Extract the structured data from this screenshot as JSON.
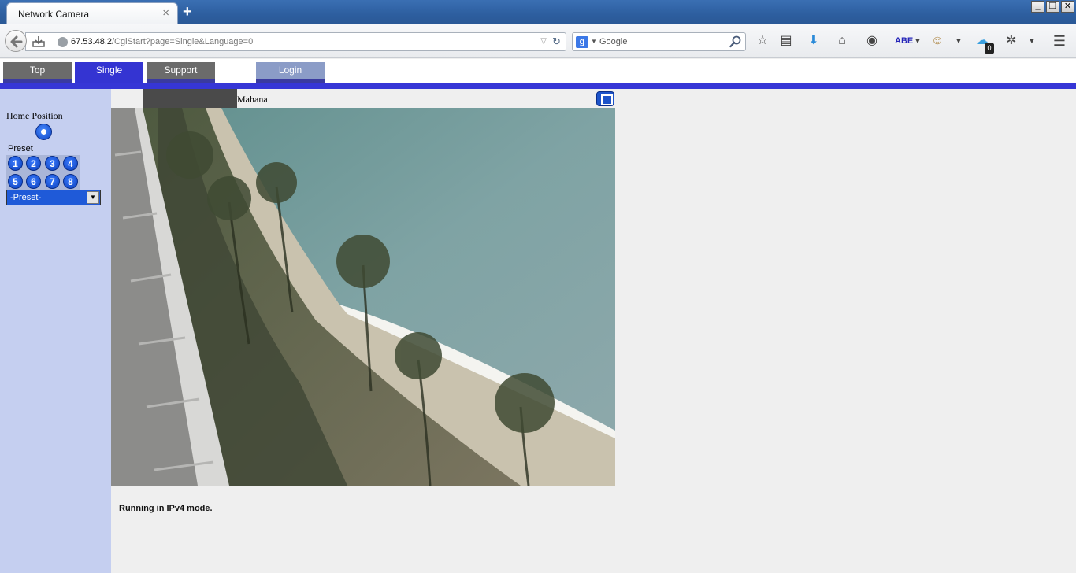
{
  "browser": {
    "tab_title": "Network Camera",
    "tab_close": "×",
    "new_tab": "+",
    "url_host": "67.53.48.2",
    "url_path": "/CgiStart?page=Single&Language=0",
    "search_placeholder": "Google",
    "window_buttons": [
      "_",
      "❐",
      "✕"
    ],
    "notification_count": "0"
  },
  "nav": {
    "tabs": [
      {
        "label": "Top"
      },
      {
        "label": "Single"
      },
      {
        "label": "Support"
      },
      {
        "label": "Login"
      }
    ]
  },
  "sidebar": {
    "home_label": "Home Position",
    "preset_label": "Preset",
    "preset_buttons": [
      "1",
      "2",
      "3",
      "4",
      "5",
      "6",
      "7",
      "8"
    ],
    "preset_select": "-Preset-"
  },
  "camera": {
    "name": "Mahana",
    "status": "Running in IPv4 mode."
  }
}
